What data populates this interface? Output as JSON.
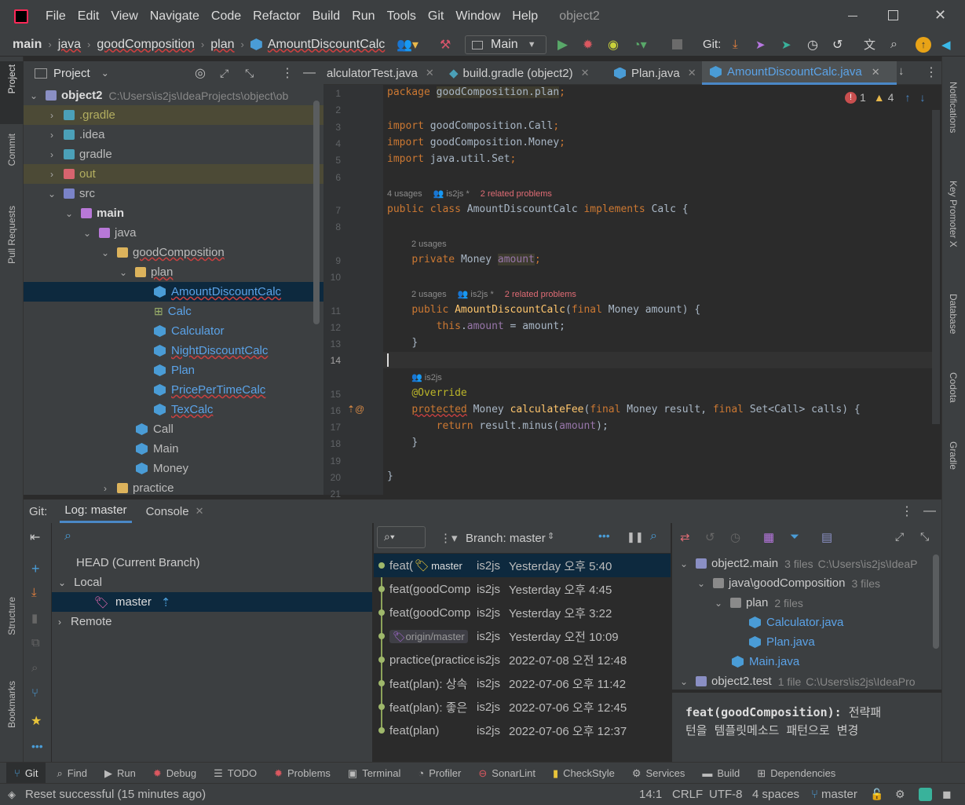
{
  "title": {
    "menu": [
      "File",
      "Edit",
      "View",
      "Navigate",
      "Code",
      "Refactor",
      "Build",
      "Run",
      "Tools",
      "Git",
      "Window",
      "Help"
    ],
    "project_name": "object2"
  },
  "nav": {
    "breadcrumbs": [
      "main",
      "java",
      "goodComposition",
      "plan",
      "AmountDiscountCalc"
    ],
    "run_config": "Main",
    "git_label": "Git:"
  },
  "project_panel": {
    "title": "Project",
    "root": {
      "name": "object2",
      "path": "C:\\Users\\is2js\\IdeaProjects\\object\\ob"
    },
    "items": [
      ".gradle",
      ".idea",
      "gradle",
      "out",
      "src",
      "main",
      "java",
      "goodComposition",
      "plan",
      "AmountDiscountCalc",
      "Calc",
      "Calculator",
      "NightDiscountCalc",
      "Plan",
      "PricePerTimeCalc",
      "TexCalc",
      "Call",
      "Main",
      "Money",
      "practice"
    ]
  },
  "tabs": [
    "alculatorTest.java",
    "build.gradle (object2)",
    "Plan.java",
    "AmountDiscountCalc.java"
  ],
  "editor": {
    "errors": "1",
    "warnings": "4",
    "lines": [
      "1",
      "2",
      "3",
      "4",
      "5",
      "6",
      "7",
      "8",
      "9",
      "10",
      "11",
      "12",
      "13",
      "14",
      "15",
      "16",
      "17",
      "18",
      "19",
      "20",
      "21"
    ],
    "hints": {
      "h7a": "4 usages",
      "h7b": "is2js *",
      "h7c": "2 related problems",
      "h9a": "2 usages",
      "h11a": "2 usages",
      "h11b": "is2js *",
      "h11c": "2 related problems",
      "h15b": "is2js"
    },
    "tokens": {
      "package": "package",
      "pkg": "goodComposition.plan",
      "semi": ";",
      "import": "import",
      "imp1": "goodComposition.Call",
      "imp2": "goodComposition.Money",
      "imp3": "java.util.Set",
      "public": "public",
      "class": "class",
      "cname": "AmountDiscountCalc",
      "implements": "implements",
      "calc": "Calc {",
      "private": "private",
      "money": "Money",
      "amount": "amount",
      "ctorOpen": "(",
      "final": "final",
      "ctorRest": "Money amount) {",
      "this": "this",
      "dot": ".",
      "assign": " = amount;",
      "rbrace": "}",
      "override": "@Override",
      "protected": "protected",
      "calcFee": "calculateFee",
      "p1": "(",
      "p2": "Money result, ",
      "p3": "Set<Call> calls) {",
      "return": "return",
      "ret": " result.minus(",
      "retEnd": ");"
    }
  },
  "bottom": {
    "git_tab": "Git:",
    "log_tab": "Log: master",
    "console_tab": "Console",
    "branches": {
      "head": "HEAD (Current Branch)",
      "local": "Local",
      "master": "master",
      "remote": "Remote"
    },
    "branch_filter": "Branch: master",
    "commits": [
      {
        "msg": "feat(",
        "tag": "master",
        "author": "is2js",
        "date": "Yesterday 오후 5:40"
      },
      {
        "msg": "feat(goodComp",
        "author": "is2js",
        "date": "Yesterday 오후 4:45"
      },
      {
        "msg": "feat(goodComp",
        "author": "is2js",
        "date": "Yesterday 오후 3:22"
      },
      {
        "msg": "",
        "tag": "origin/master",
        "author": "is2js",
        "date": "Yesterday 오전 10:09"
      },
      {
        "msg": "practice(practice",
        "author": "is2js",
        "date": "2022-07-08 오전 12:48"
      },
      {
        "msg": "feat(plan): 상속",
        "author": "is2js",
        "date": "2022-07-06 오후 11:42"
      },
      {
        "msg": "feat(plan): 좋은",
        "author": "is2js",
        "date": "2022-07-06 오후 12:45"
      },
      {
        "msg": "feat(plan)",
        "author": "is2js",
        "date": "2022-07-06 오후 12:37"
      }
    ],
    "details": {
      "root": "object2.main",
      "root_count": "3 files",
      "root_path": "C:\\Users\\is2js\\IdeaP",
      "dir1": "java\\goodComposition",
      "dir1_count": "3 files",
      "dir2": "plan",
      "dir2_count": "2 files",
      "f1": "Calculator.java",
      "f2": "Plan.java",
      "f3": "Main.java",
      "root2": "object2.test",
      "root2_count": "1 file",
      "root2_path": "C:\\Users\\is2js\\IdeaPro",
      "message_bold": "feat(goodComposition):",
      "message_rest1": " 전략패",
      "message_rest2": "턴을 템플릿메소드 패턴으로 변경"
    }
  },
  "left_tool": [
    "Project",
    "Commit",
    "Pull Requests",
    "Structure",
    "Bookmarks"
  ],
  "right_tool": [
    "Notifications",
    "Key Promoter X",
    "Database",
    "Codota",
    "Gradle"
  ],
  "tool_windows": [
    "Git",
    "Find",
    "Run",
    "Debug",
    "TODO",
    "Problems",
    "Terminal",
    "Profiler",
    "SonarLint",
    "CheckStyle",
    "Services",
    "Build",
    "Dependencies"
  ],
  "status": {
    "message": "Reset successful (15 minutes ago)",
    "position": "14:1",
    "line_sep": "CRLF",
    "encoding": "UTF-8",
    "indent": "4 spaces",
    "branch": "master"
  }
}
